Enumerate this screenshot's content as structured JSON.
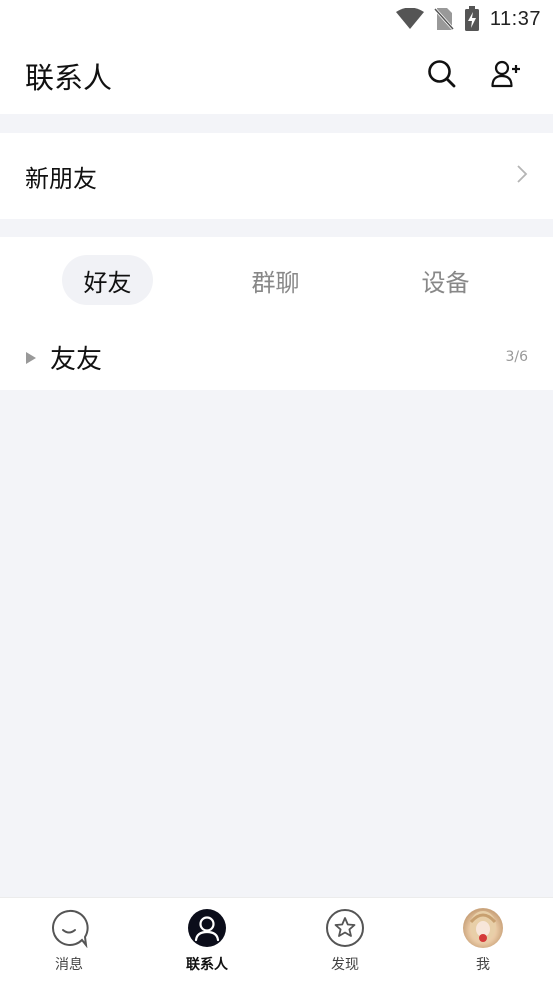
{
  "status_bar": {
    "time": "11:37",
    "icons": [
      "wifi-icon",
      "no-sim-icon",
      "battery-charging-icon"
    ]
  },
  "header": {
    "title": "联系人",
    "icons": [
      "search-icon",
      "add-contact-icon"
    ]
  },
  "new_friends": {
    "label": "新朋友",
    "icon": "chevron-right-icon"
  },
  "tabs": [
    {
      "label": "好友",
      "active": true
    },
    {
      "label": "群聊",
      "active": false
    },
    {
      "label": "设备",
      "active": false
    }
  ],
  "groups": [
    {
      "name": "友友",
      "count": "3/6"
    }
  ],
  "bottom_nav": [
    {
      "label": "消息",
      "icon": "chat-bubble-icon",
      "active": false
    },
    {
      "label": "联系人",
      "icon": "contacts-icon",
      "active": true
    },
    {
      "label": "发现",
      "icon": "star-icon",
      "active": false
    },
    {
      "label": "我",
      "icon": "avatar",
      "active": false
    }
  ],
  "colors": {
    "background": "#f3f4f8",
    "surface": "#ffffff",
    "active_tab_bg": "#f1f2f6",
    "text_primary": "#111111",
    "text_secondary": "#888888"
  }
}
